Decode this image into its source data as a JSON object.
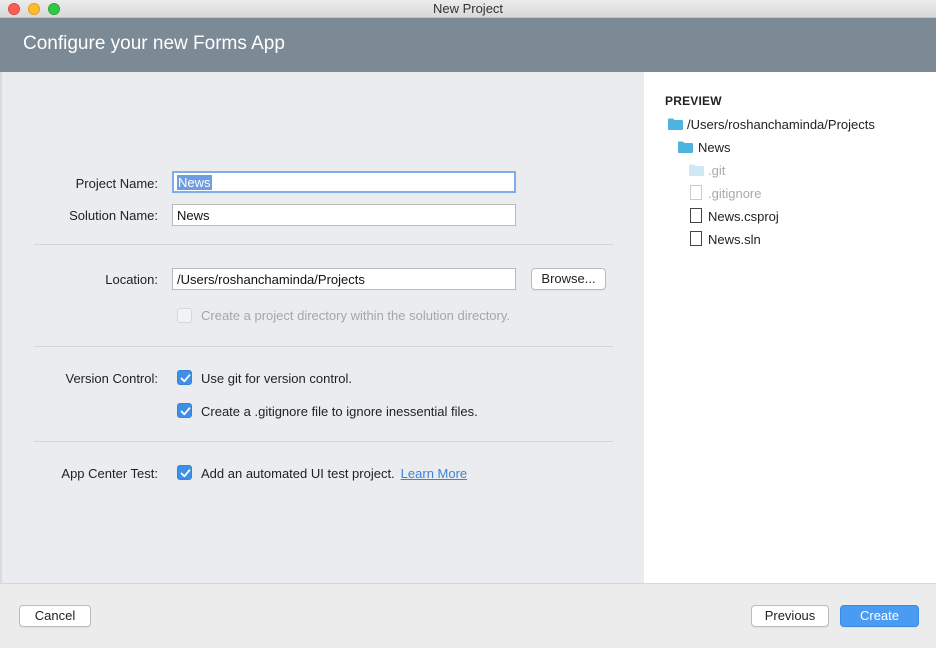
{
  "window": {
    "title": "New Project"
  },
  "header": {
    "title": "Configure your new Forms App"
  },
  "form": {
    "project_name_label": "Project Name:",
    "project_name_value": "News",
    "solution_name_label": "Solution Name:",
    "solution_name_value": "News",
    "location_label": "Location:",
    "location_value": "/Users/roshanchaminda/Projects",
    "browse_label": "Browse...",
    "create_dir_label": "Create a project directory within the solution directory.",
    "create_dir_checked": false,
    "version_control_label": "Version Control:",
    "use_git_label": "Use git for version control.",
    "use_git_checked": true,
    "gitignore_label": "Create a .gitignore file to ignore inessential files.",
    "gitignore_checked": true,
    "app_center_label": "App Center Test:",
    "ui_test_label": "Add an automated UI test project.",
    "ui_test_checked": true,
    "learn_more_label": "Learn More"
  },
  "preview": {
    "heading": "PREVIEW",
    "items": [
      {
        "label": "/Users/roshanchaminda/Projects",
        "icon": "folder-icon",
        "dim": false
      },
      {
        "label": "News",
        "icon": "folder-icon",
        "dim": false
      },
      {
        "label": ".git",
        "icon": "folder-icon",
        "dim": true
      },
      {
        "label": ".gitignore",
        "icon": "file-icon",
        "dim": true
      },
      {
        "label": "News.csproj",
        "icon": "file-icon",
        "dim": false
      },
      {
        "label": "News.sln",
        "icon": "file-icon",
        "dim": false
      }
    ]
  },
  "footer": {
    "cancel_label": "Cancel",
    "previous_label": "Previous",
    "create_label": "Create"
  },
  "colors": {
    "header_bg": "#7c8a96",
    "accent": "#4a9cf2",
    "folder": "#4fb3e0"
  }
}
